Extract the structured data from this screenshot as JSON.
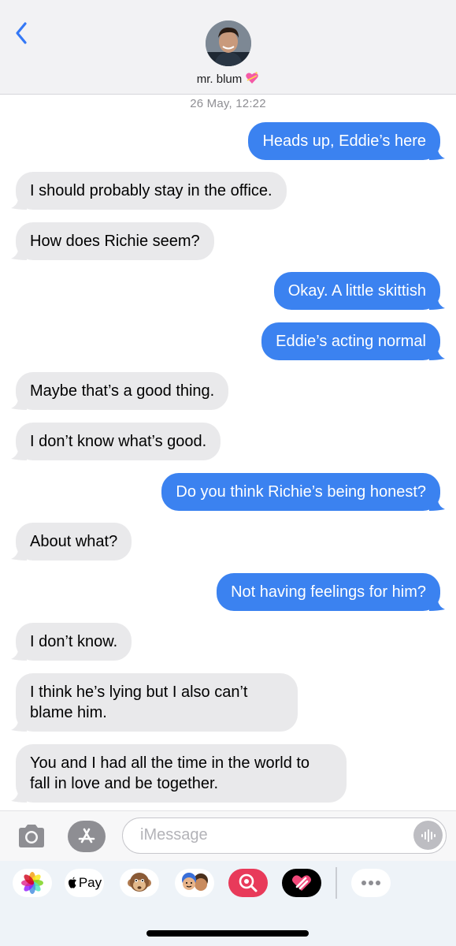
{
  "header": {
    "contact_name": "mr. blum",
    "heart_emoji": "💖"
  },
  "timestamp": "26 May, 12:22",
  "messages": [
    {
      "dir": "out",
      "text": "Heads up, Eddie’s here"
    },
    {
      "dir": "in",
      "text": "I should probably stay in the office."
    },
    {
      "dir": "in",
      "text": "How does Richie seem?"
    },
    {
      "dir": "out",
      "text": "Okay. A little skittish"
    },
    {
      "dir": "out",
      "text": "Eddie’s acting normal"
    },
    {
      "dir": "in",
      "text": "Maybe that’s a good thing."
    },
    {
      "dir": "in",
      "text": "I don’t know what’s good."
    },
    {
      "dir": "out",
      "text": "Do you think Richie’s being honest?"
    },
    {
      "dir": "in",
      "text": "About what?"
    },
    {
      "dir": "out",
      "text": "Not having feelings for him?"
    },
    {
      "dir": "in",
      "text": "I don’t know."
    },
    {
      "dir": "in",
      "text": "I think he’s lying but I also can’t blame him."
    },
    {
      "dir": "in",
      "text": "You and I had all the time in the world to fall in love and be together."
    }
  ],
  "input": {
    "placeholder": "iMessage"
  },
  "app_strip": {
    "apple_pay_label": "Pay",
    "icons": [
      "photos-icon",
      "apple-pay-icon",
      "animoji-icon",
      "memoji-icon",
      "image-search-icon",
      "digital-touch-icon",
      "more-apps-icon"
    ]
  },
  "colors": {
    "outgoing_bubble": "#3b82f0",
    "incoming_bubble": "#e9e9eb",
    "back_chevron": "#3478f6"
  }
}
